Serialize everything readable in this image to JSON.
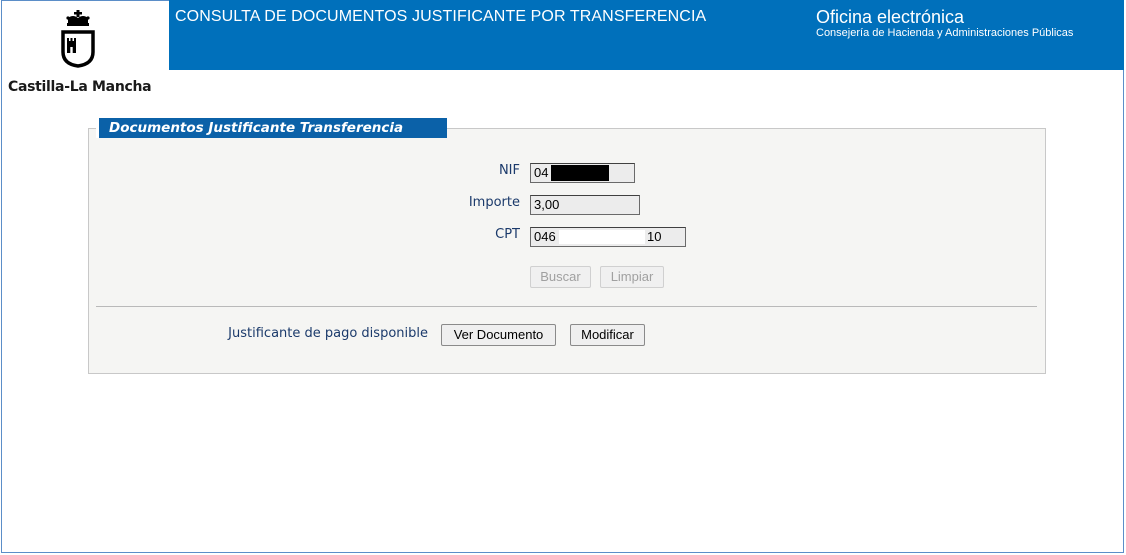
{
  "brand": {
    "logo_text": "Castilla-La Mancha"
  },
  "header": {
    "title": "CONSULTA DE DOCUMENTOS JUSTIFICANTE POR TRANSFERENCIA",
    "office": "Oficina electrónica",
    "department": "Consejería de Hacienda y Administraciones Públicas",
    "bar_color": "#0070bb"
  },
  "panel": {
    "title": "Documentos Justificante Transferencia",
    "fields": {
      "nif": {
        "label": "NIF",
        "value": "04"
      },
      "importe": {
        "label": "Importe",
        "value": "3,00"
      },
      "cpt": {
        "label": "CPT",
        "value_prefix": "046",
        "value_suffix": "10"
      }
    },
    "buttons": {
      "search": "Buscar",
      "clear": "Limpiar"
    },
    "result": {
      "label": "Justificante de pago disponible",
      "view_button": "Ver Documento",
      "modify_button": "Modificar"
    }
  }
}
